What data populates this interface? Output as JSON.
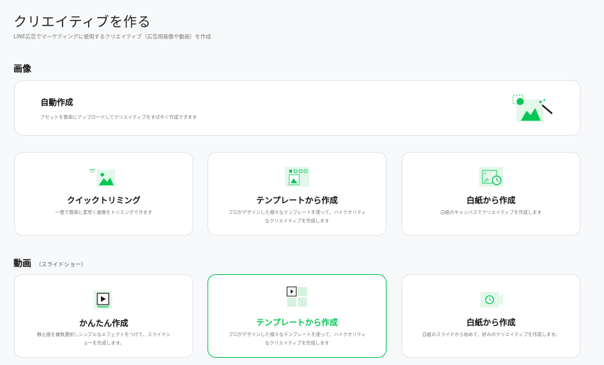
{
  "header": {
    "title": "クリエイティブを作る",
    "subtitle": "LINE広告でマーケティングに使用するクリエイティブ（広告用画像や動画）を作成"
  },
  "image_section": {
    "title": "画像",
    "auto_card": {
      "title": "自動作成",
      "desc": "アセットを簡単にアップロードしてクリエイティブをすばやく作成できます",
      "icon": "magic-image-icon"
    },
    "cards": [
      {
        "title": "クイックトリミング",
        "desc": "一度で簡単に素早く画像をトリミングできます",
        "icon": "trim-image-icon"
      },
      {
        "title": "テンプレートから作成",
        "desc": "プロがデザインした様々なテンプレートを使って、ハイクオリティなクリエイティブを作成します",
        "icon": "template-image-icon"
      },
      {
        "title": "白紙から作成",
        "desc": "白紙のキャンバスでクリエイティブを作成します",
        "icon": "blank-image-icon"
      }
    ]
  },
  "video_section": {
    "title": "動画",
    "subtitle": "（スライドショー）",
    "cards": [
      {
        "title": "かんたん作成",
        "desc": "静止画を複数選択しシンプルなエフェクトをつけて、スライドショーを作成します。",
        "icon": "easy-video-icon"
      },
      {
        "title": "テンプレートから作成",
        "desc": "プロがデザインした様々なテンプレートを使って、ハイクオリティなクリエイティブを作成します",
        "icon": "template-video-icon"
      },
      {
        "title": "白紙から作成",
        "desc": "白紙のスライドから始めて、好みのクリエイティブを作成します。",
        "icon": "blank-video-icon"
      }
    ]
  },
  "colors": {
    "accent": "#06c755",
    "icon_bg": "#e3f7ea",
    "icon_green": "#06c755"
  }
}
